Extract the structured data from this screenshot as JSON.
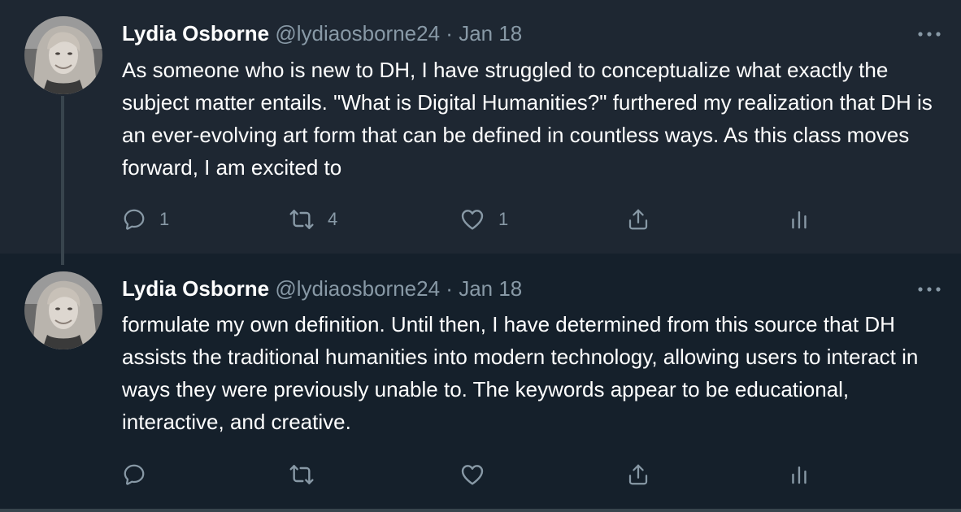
{
  "thread": {
    "tweets": [
      {
        "author": {
          "display_name": "Lydia Osborne",
          "handle": "@lydiaosborne24"
        },
        "separator": "·",
        "date": "Jan 18",
        "text": "As someone who is new to DH, I have struggled to conceptualize what exactly the subject matter entails. \"What is Digital Humanities?\" furthered my realization that DH is an ever-evolving art form that can be defined in countless ways. As this class moves forward, I am excited to",
        "actions": {
          "reply_count": "1",
          "retweet_count": "4",
          "like_count": "1"
        }
      },
      {
        "author": {
          "display_name": "Lydia Osborne",
          "handle": "@lydiaosborne24"
        },
        "separator": "·",
        "date": "Jan 18",
        "text": "formulate my own definition. Until then, I have determined from this source that DH assists the traditional humanities into modern technology, allowing users to interact in ways they were previously unable to. The keywords appear to be educational, interactive, and creative.",
        "actions": {
          "reply_count": "",
          "retweet_count": "",
          "like_count": ""
        }
      }
    ]
  },
  "icons": {
    "reply": "reply-icon",
    "retweet": "retweet-icon",
    "like": "heart-icon",
    "share": "share-icon",
    "analytics": "analytics-icon",
    "more": "more-options-icon"
  },
  "colors": {
    "background": "#15202b",
    "highlighted_background": "#1e2732",
    "secondary_text": "#8899a6",
    "divider": "#38444d",
    "primary_text": "#ffffff"
  }
}
